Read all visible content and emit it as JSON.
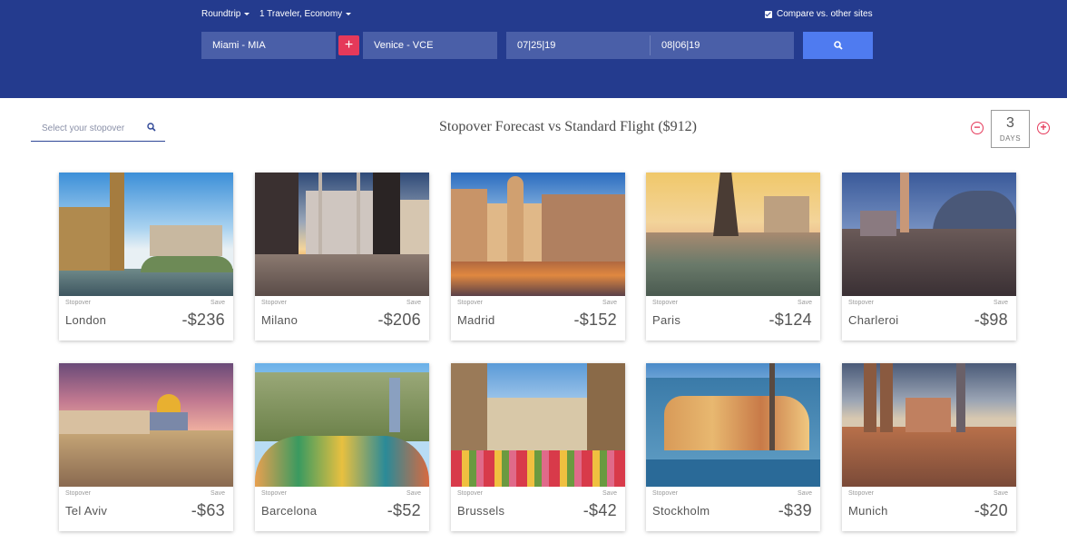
{
  "header": {
    "trip_type": "Roundtrip",
    "travelers": "1 Traveler, Economy",
    "compare_label": "Compare vs. other sites",
    "origin": "Miami - MIA",
    "destination": "Venice - VCE",
    "depart_date": "07|25|19",
    "return_date": "08|06|19",
    "swap_symbol": "+"
  },
  "toolbar": {
    "stopover_placeholder": "Select your stopover",
    "title": "Stopover Forecast vs Standard Flight ($912)",
    "days_value": "3",
    "days_label": "DAYS",
    "minus_symbol": "−",
    "plus_symbol": "+"
  },
  "colors": {
    "header_bg": "#243b8e",
    "field_bg": "#4a5fa8",
    "accent": "#e5395a",
    "search_bg": "#4f7bf0"
  },
  "cards": [
    {
      "stopover_label": "Stopover",
      "save_label": "Save",
      "city": "London",
      "price": "-$236"
    },
    {
      "stopover_label": "Stopover",
      "save_label": "Save",
      "city": "Milano",
      "price": "-$206"
    },
    {
      "stopover_label": "Stopover",
      "save_label": "Save",
      "city": "Madrid",
      "price": "-$152"
    },
    {
      "stopover_label": "Stopover",
      "save_label": "Save",
      "city": "Paris",
      "price": "-$124"
    },
    {
      "stopover_label": "Stopover",
      "save_label": "Save",
      "city": "Charleroi",
      "price": "-$98"
    },
    {
      "stopover_label": "Stopover",
      "save_label": "Save",
      "city": "Tel Aviv",
      "price": "-$63"
    },
    {
      "stopover_label": "Stopover",
      "save_label": "Save",
      "city": "Barcelona",
      "price": "-$52"
    },
    {
      "stopover_label": "Stopover",
      "save_label": "Save",
      "city": "Brussels",
      "price": "-$42"
    },
    {
      "stopover_label": "Stopover",
      "save_label": "Save",
      "city": "Stockholm",
      "price": "-$39"
    },
    {
      "stopover_label": "Stopover",
      "save_label": "Save",
      "city": "Munich",
      "price": "-$20"
    }
  ]
}
